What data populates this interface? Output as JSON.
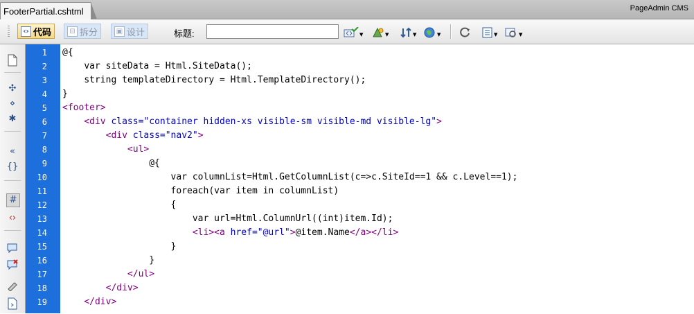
{
  "tab": {
    "filename": "FooterPartial.cshtml"
  },
  "app": {
    "brand": "PageAdmin CMS"
  },
  "toolbar": {
    "view_code_label": "代码",
    "view_split_label": "拆分",
    "view_design_label": "设计",
    "title_label": "标题:",
    "title_value": "",
    "icons": [
      "validate-icon",
      "live-view-icon",
      "sort-icon",
      "globe-icon",
      "refresh-icon",
      "view-options-icon",
      "visual-aids-icon"
    ]
  },
  "rail": {
    "icons": [
      "open-documents-icon",
      "collapse-tag-icon",
      "collapse-selection-icon",
      "expand-all-icon",
      "select-parent-tag-icon",
      "balance-braces-icon",
      "line-numbers-icon",
      "highlight-invalid-icon",
      "apply-comment-icon",
      "remove-comment-icon",
      "wrap-tag-icon",
      "recent-snippets-icon"
    ]
  },
  "editor": {
    "colors": {
      "gutter": "#1d6fdc",
      "tag": "#800080",
      "attr_value": "#0000c8"
    },
    "lines": [
      {
        "n": "1",
        "indent": "",
        "parts": [
          {
            "t": "@{",
            "c": "razor"
          }
        ]
      },
      {
        "n": "2",
        "indent": "    ",
        "parts": [
          {
            "t": "var siteData = Html.SiteData();",
            "c": "plain"
          }
        ]
      },
      {
        "n": "3",
        "indent": "    ",
        "parts": [
          {
            "t": "string templateDirectory = Html.TemplateDirectory();",
            "c": "plain"
          }
        ]
      },
      {
        "n": "4",
        "indent": "",
        "parts": [
          {
            "t": "}",
            "c": "razor"
          }
        ]
      },
      {
        "n": "5",
        "indent": "",
        "parts": [
          {
            "t": "<footer>",
            "c": "tag"
          }
        ]
      },
      {
        "n": "6",
        "indent": "    ",
        "parts": [
          {
            "t": "<div ",
            "c": "tag"
          },
          {
            "t": "class=\"container hidden-xs visible-sm visible-md visible-lg\"",
            "c": "val"
          },
          {
            "t": ">",
            "c": "tag"
          }
        ]
      },
      {
        "n": "7",
        "indent": "        ",
        "parts": [
          {
            "t": "<div ",
            "c": "tag"
          },
          {
            "t": "class=\"nav2\"",
            "c": "val"
          },
          {
            "t": ">",
            "c": "tag"
          }
        ]
      },
      {
        "n": "8",
        "indent": "            ",
        "parts": [
          {
            "t": "<ul>",
            "c": "tag"
          }
        ]
      },
      {
        "n": "9",
        "indent": "                ",
        "parts": [
          {
            "t": "@{",
            "c": "razor"
          }
        ]
      },
      {
        "n": "10",
        "indent": "                    ",
        "parts": [
          {
            "t": "var columnList=Html.GetColumnList(c=>c.SiteId==1 && c.Level==1);",
            "c": "plain"
          }
        ]
      },
      {
        "n": "11",
        "indent": "                    ",
        "parts": [
          {
            "t": "foreach(var item in columnList)",
            "c": "plain"
          }
        ]
      },
      {
        "n": "12",
        "indent": "                    ",
        "parts": [
          {
            "t": "{",
            "c": "plain"
          }
        ]
      },
      {
        "n": "13",
        "indent": "                        ",
        "parts": [
          {
            "t": "var url=Html.ColumnUrl((int)item.Id);",
            "c": "plain"
          }
        ]
      },
      {
        "n": "14",
        "indent": "                        ",
        "parts": [
          {
            "t": "<li><a ",
            "c": "tag"
          },
          {
            "t": "href=\"@url\"",
            "c": "val"
          },
          {
            "t": ">",
            "c": "tag"
          },
          {
            "t": "@item.Name",
            "c": "plain"
          },
          {
            "t": "</a></li>",
            "c": "tag"
          }
        ]
      },
      {
        "n": "15",
        "indent": "                    ",
        "parts": [
          {
            "t": "}",
            "c": "plain"
          }
        ]
      },
      {
        "n": "16",
        "indent": "                ",
        "parts": [
          {
            "t": "}",
            "c": "razor"
          }
        ]
      },
      {
        "n": "17",
        "indent": "            ",
        "parts": [
          {
            "t": "</ul>",
            "c": "tag"
          }
        ]
      },
      {
        "n": "18",
        "indent": "        ",
        "parts": [
          {
            "t": "</div>",
            "c": "tag"
          }
        ]
      },
      {
        "n": "19",
        "indent": "    ",
        "parts": [
          {
            "t": "</div>",
            "c": "tag"
          }
        ]
      }
    ]
  }
}
